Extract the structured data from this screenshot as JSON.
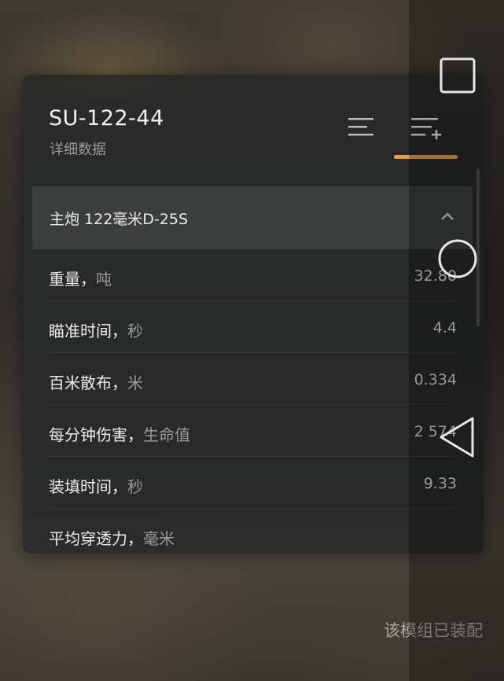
{
  "panel": {
    "title": "SU-122-44",
    "subtitle": "详细数据",
    "tabs": [
      {
        "icon": "list-icon",
        "selected": false
      },
      {
        "icon": "list-add-icon",
        "selected": true
      }
    ],
    "accent_color": "#f2a020"
  },
  "section": {
    "title": "主炮 122毫米D-25S",
    "expanded": true
  },
  "rows": [
    {
      "label": "重量，",
      "unit": "吨",
      "value": "32.80"
    },
    {
      "label": "瞄准时间，",
      "unit": "秒",
      "value": "4.4"
    },
    {
      "label": "百米散布，",
      "unit": "米",
      "value": "0.334"
    },
    {
      "label": "每分钟伤害，",
      "unit": "生命值",
      "value": "2 574"
    },
    {
      "label": "装填时间，",
      "unit": "秒",
      "value": "9.33"
    },
    {
      "label": "平均穿透力，",
      "unit": "毫米",
      "value": ""
    }
  ],
  "status": {
    "text": "该模组已装配"
  },
  "navbar": {
    "buttons": [
      "recent-apps-icon",
      "home-icon",
      "back-icon"
    ]
  }
}
